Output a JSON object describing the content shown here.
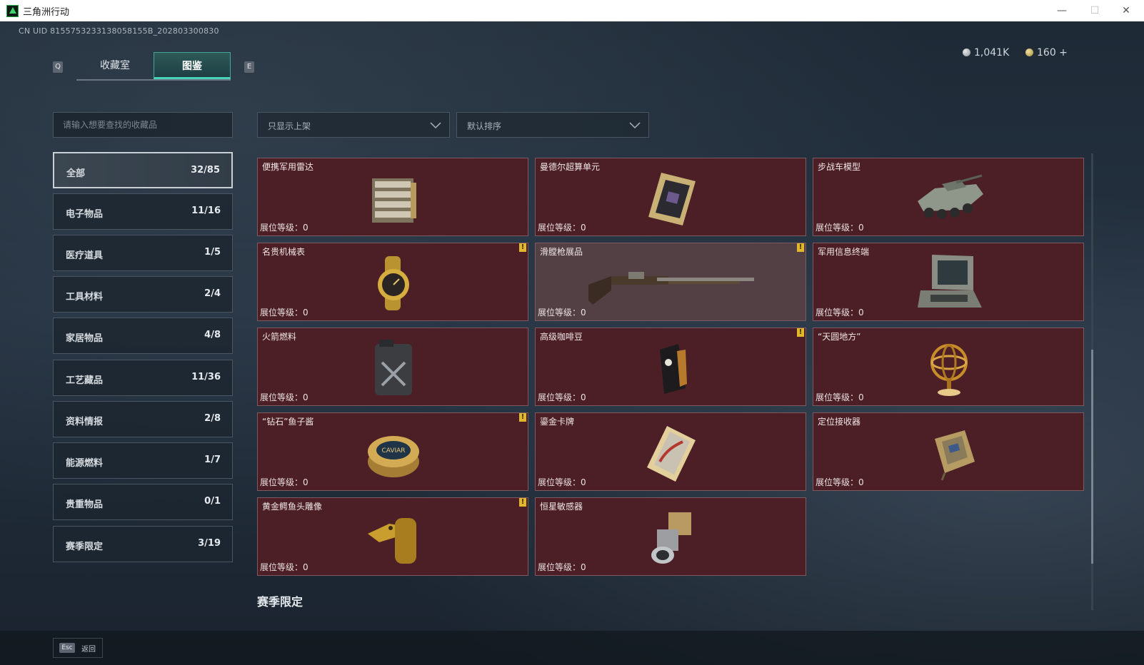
{
  "window": {
    "title": "三角洲行动",
    "min_label": "—",
    "max_label": "☐",
    "close_label": "✕"
  },
  "uid_text": "CN UID 8155753233138058155B_202803300830",
  "keys": {
    "prev": "Q",
    "next": "E"
  },
  "tabs": [
    {
      "label": "收藏室",
      "active": false
    },
    {
      "label": "图鉴",
      "active": true
    }
  ],
  "currency": {
    "silver": "1,041K",
    "gold": "160 +"
  },
  "search": {
    "placeholder": "请输入想要查找的收藏品"
  },
  "filters": {
    "availability": "只显示上架",
    "sort": "默认排序"
  },
  "categories": [
    {
      "name": "全部",
      "count": "32/85",
      "active": true
    },
    {
      "name": "电子物品",
      "count": "11/16"
    },
    {
      "name": "医疗道具",
      "count": "1/5"
    },
    {
      "name": "工具材料",
      "count": "2/4"
    },
    {
      "name": "家居物品",
      "count": "4/8"
    },
    {
      "name": "工艺藏品",
      "count": "11/36"
    },
    {
      "name": "资料情报",
      "count": "2/8"
    },
    {
      "name": "能源燃料",
      "count": "1/7"
    },
    {
      "name": "贵重物品",
      "count": "0/1"
    },
    {
      "name": "赛季限定",
      "count": "3/19"
    }
  ],
  "items": [
    {
      "name": "便携军用雷达",
      "level": "展位等级：0",
      "icon": "radar",
      "warn": false
    },
    {
      "name": "曼德尔超算单元",
      "level": "展位等级：0",
      "icon": "computer-unit",
      "warn": false
    },
    {
      "name": "步战车模型",
      "level": "展位等级：0",
      "icon": "ifv-model",
      "warn": false
    },
    {
      "name": "名贵机械表",
      "level": "展位等级：0",
      "icon": "watch",
      "warn": true
    },
    {
      "name": "滑膛枪展品",
      "level": "展位等级：0",
      "icon": "musket",
      "warn": true,
      "highlight": true
    },
    {
      "name": "军用信息终端",
      "level": "展位等级：0",
      "icon": "terminal",
      "warn": false
    },
    {
      "name": "火箭燃料",
      "level": "展位等级：0",
      "icon": "fuel-can",
      "warn": false
    },
    {
      "name": "高级咖啡豆",
      "level": "展位等级：0",
      "icon": "coffee-bag",
      "warn": true
    },
    {
      "name": "“天圆地方”",
      "level": "展位等级：0",
      "icon": "armillary",
      "warn": false
    },
    {
      "name": "“钻石”鱼子酱",
      "level": "展位等级：0",
      "icon": "caviar-tin",
      "warn": true,
      "icon_text": "CAVIAR"
    },
    {
      "name": "鎏金卡牌",
      "level": "展位等级：0",
      "icon": "gold-card",
      "warn": false
    },
    {
      "name": "定位接收器",
      "level": "展位等级：0",
      "icon": "receiver",
      "warn": false
    },
    {
      "name": "黄金鳄鱼头雕像",
      "level": "展位等级：0",
      "icon": "croc-statue",
      "warn": true
    },
    {
      "name": "恒星敏感器",
      "level": "展位等级：0",
      "icon": "star-sensor",
      "warn": false
    }
  ],
  "warn_mark": "!",
  "section_title": "赛季限定",
  "footer": {
    "esc_key": "Esc",
    "back_label": "返回"
  },
  "colors": {
    "card_bg": "#4b1f25",
    "card_highlight": "#534045",
    "tab_accent": "#46d3b8",
    "warn": "#e1b82a"
  }
}
